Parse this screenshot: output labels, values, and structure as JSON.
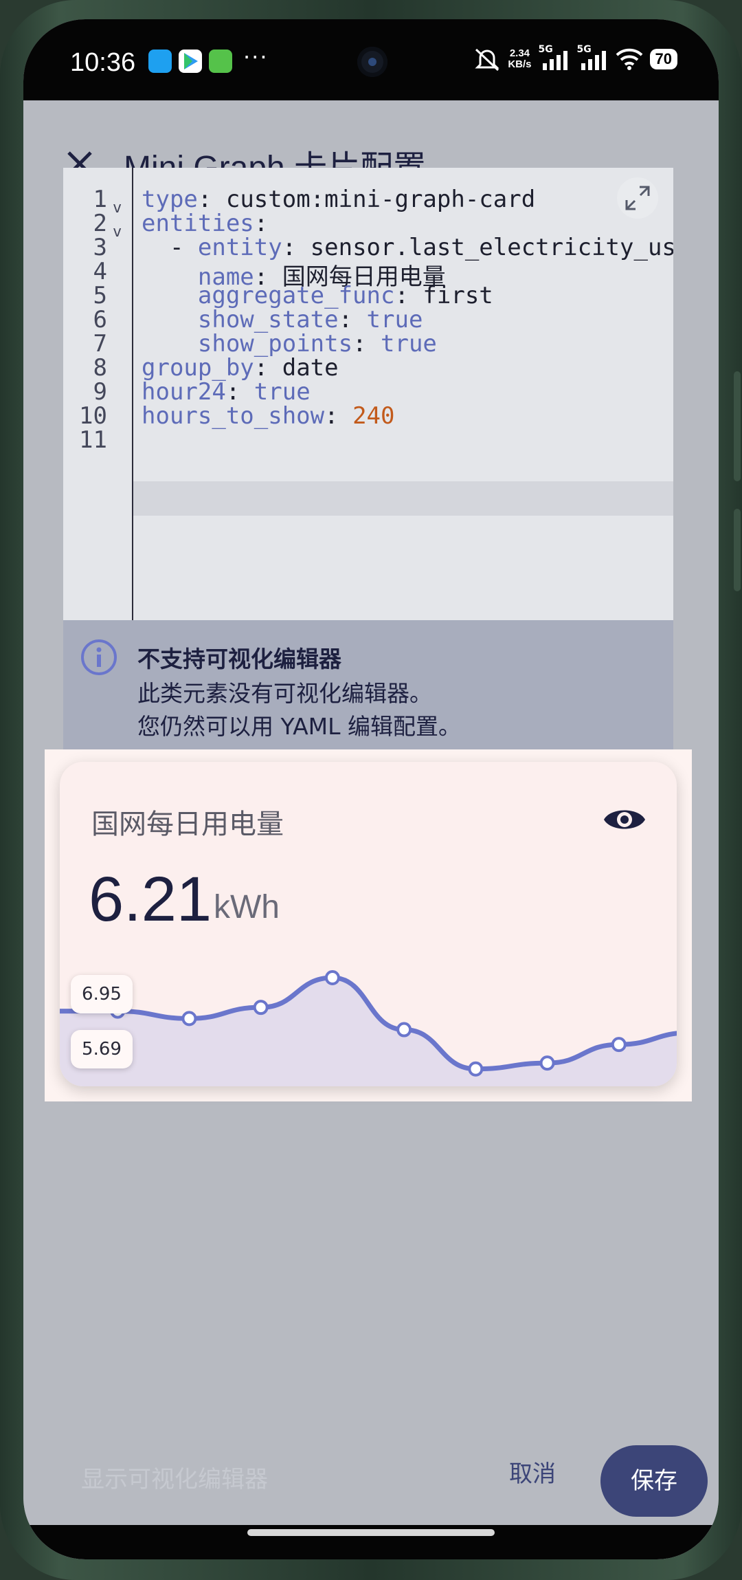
{
  "status_bar": {
    "time": "10:36",
    "more": "···",
    "net_speed_value": "2.34",
    "net_speed_unit": "KB/s",
    "signal1": "5G",
    "signal2": "5G",
    "battery": "70"
  },
  "dialog": {
    "title": "Mini Graph 卡片配置"
  },
  "editor": {
    "line_numbers": [
      "1",
      "2",
      "3",
      "4",
      "5",
      "6",
      "7",
      "8",
      "9",
      "10",
      "11"
    ],
    "lines": [
      {
        "indent": "",
        "key": "type",
        "sep": ": ",
        "value": "custom:mini-graph-card"
      },
      {
        "indent": "",
        "key": "entities",
        "sep": ":",
        "value": ""
      },
      {
        "indent": "  - ",
        "key": "entity",
        "sep": ": ",
        "value": "sensor.last_electricity_usage"
      },
      {
        "indent": "    ",
        "key": "name",
        "sep": ": ",
        "value": "国网每日用电量"
      },
      {
        "indent": "    ",
        "key": "aggregate_func",
        "sep": ": ",
        "value": "first"
      },
      {
        "indent": "    ",
        "key": "show_state",
        "sep": ": ",
        "value": "true"
      },
      {
        "indent": "    ",
        "key": "show_points",
        "sep": ": ",
        "value": "true"
      },
      {
        "indent": "",
        "key": "group_by",
        "sep": ": ",
        "value": "date"
      },
      {
        "indent": "",
        "key": "hour24",
        "sep": ": ",
        "value": "true"
      },
      {
        "indent": "",
        "key": "hours_to_show",
        "sep": ": ",
        "value": "240"
      },
      {
        "indent": "",
        "key": "",
        "sep": "",
        "value": ""
      }
    ],
    "fold_marker": "v",
    "highlighted_line": 9
  },
  "alert": {
    "title": "不支持可视化编辑器",
    "line1": "此类元素没有可视化编辑器。",
    "line2": "您仍然可以用 YAML 编辑配置。"
  },
  "card": {
    "name": "国网每日用电量",
    "state": "6.21",
    "unit": "kWh",
    "max_label": "6.95",
    "min_label": "5.69",
    "line_color": "#6a76cc",
    "fill_color": "#e3dcec"
  },
  "chart_data": {
    "type": "line",
    "title": "",
    "xlabel": "",
    "ylabel": "",
    "values": [
      6.5,
      6.5,
      6.4,
      6.55,
      6.95,
      6.25,
      5.72,
      5.8,
      6.05,
      6.21
    ],
    "ylim": [
      5.69,
      6.95
    ]
  },
  "footer": {
    "show_visual_editor": "显示可视化编辑器",
    "cancel": "取消",
    "save": "保存"
  }
}
